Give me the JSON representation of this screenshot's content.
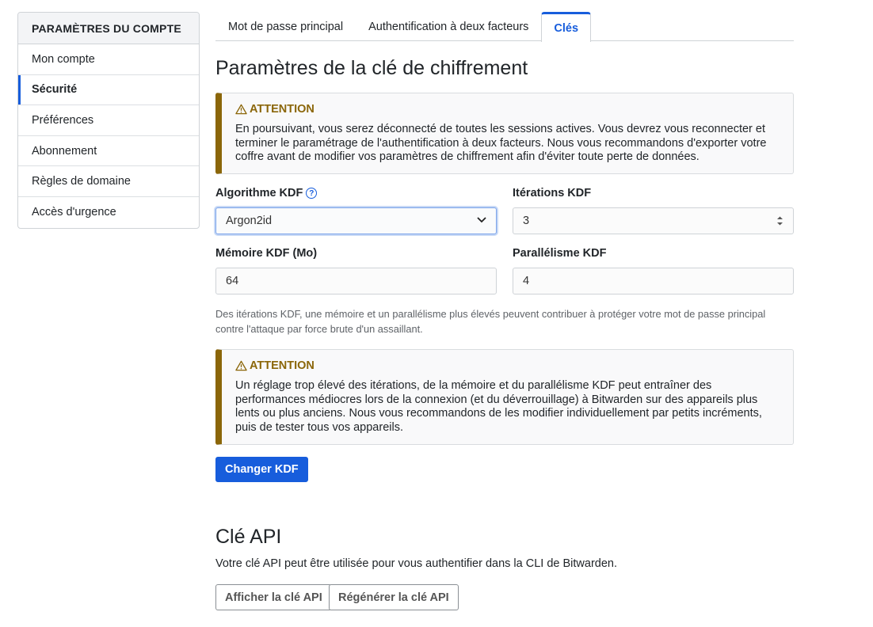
{
  "sidebar": {
    "header": "PARAMÈTRES DU COMPTE",
    "items": [
      {
        "label": "Mon compte"
      },
      {
        "label": "Sécurité"
      },
      {
        "label": "Préférences"
      },
      {
        "label": "Abonnement"
      },
      {
        "label": "Règles de domaine"
      },
      {
        "label": "Accès d'urgence"
      }
    ],
    "active_item": "Sécurité"
  },
  "tabs": [
    {
      "label": "Mot de passe principal"
    },
    {
      "label": "Authentification à deux facteurs"
    },
    {
      "label": "Clés"
    }
  ],
  "active_tab": "Clés",
  "encryption": {
    "title": "Paramètres de la clé de chiffrement",
    "warning1": {
      "title": "ATTENTION",
      "body": "En poursuivant, vous serez déconnecté de toutes les sessions actives. Vous devrez vous reconnecter et terminer le paramétrage de l'authentification à deux facteurs. Nous vous recommandons d'exporter votre coffre avant de modifier vos paramètres de chiffrement afin d'éviter toute perte de données."
    },
    "kdf_algorithm_label": "Algorithme KDF",
    "kdf_algorithm_value": "Argon2id",
    "kdf_iterations_label": "Itérations KDF",
    "kdf_iterations_value": "3",
    "kdf_memory_label": "Mémoire KDF (Mo)",
    "kdf_memory_value": "64",
    "kdf_parallelism_label": "Parallélisme KDF",
    "kdf_parallelism_value": "4",
    "help_text": "Des itérations KDF, une mémoire et un parallélisme plus élevés peuvent contribuer à protéger votre mot de passe principal contre l'attaque par force brute d'un assaillant.",
    "warning2": {
      "title": "ATTENTION",
      "body": "Un réglage trop élevé des itérations, de la mémoire et du parallélisme KDF peut entraîner des performances médiocres lors de la connexion (et du déverrouillage) à Bitwarden sur des appareils plus lents ou plus anciens. Nous vous recommandons de les modifier individuellement par petits incréments, puis de tester tous vos appareils."
    },
    "change_button": "Changer KDF"
  },
  "api": {
    "title": "Clé API",
    "description": "Votre clé API peut être utilisée pour vous authentifier dans la CLI de Bitwarden.",
    "view_button": "Afficher la clé API",
    "regenerate_button": "Régénérer la clé API"
  },
  "colors": {
    "primary": "#175ddc",
    "warning": "#8b6609"
  },
  "icons": {
    "warning": "warning-triangle-icon",
    "help": "question-circle-icon",
    "select": "chevron-down-icon",
    "stepper": "stepper-arrows-icon"
  }
}
